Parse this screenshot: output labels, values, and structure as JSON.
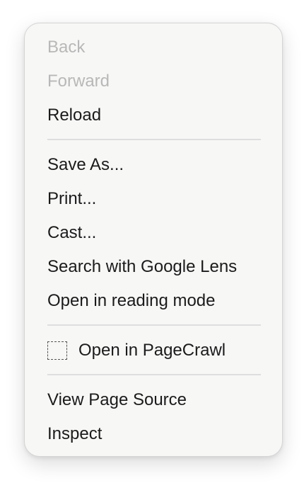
{
  "menu": {
    "items": [
      {
        "label": "Back",
        "enabled": false
      },
      {
        "label": "Forward",
        "enabled": false
      },
      {
        "label": "Reload",
        "enabled": true
      },
      {
        "label": "Save As...",
        "enabled": true
      },
      {
        "label": "Print...",
        "enabled": true
      },
      {
        "label": "Cast...",
        "enabled": true
      },
      {
        "label": "Search with Google Lens",
        "enabled": true
      },
      {
        "label": "Open in reading mode",
        "enabled": true
      },
      {
        "label": "Open in PageCrawl",
        "enabled": true,
        "icon": "extension-placeholder-icon"
      },
      {
        "label": "View Page Source",
        "enabled": true
      },
      {
        "label": "Inspect",
        "enabled": true
      }
    ]
  },
  "colors": {
    "text": "#1b1b1b",
    "disabled_text": "#b8b8b8",
    "menu_background": "#f7f7f6",
    "separator": "#dedede"
  }
}
